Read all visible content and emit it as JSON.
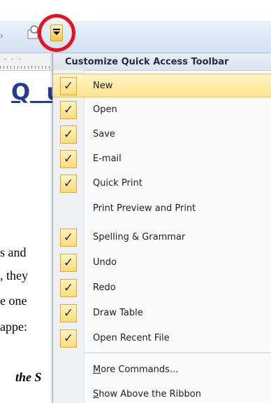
{
  "menu": {
    "title": "Customize Quick Access Toolbar",
    "items": [
      {
        "label": "New",
        "checked": true,
        "active": true
      },
      {
        "label": "Open",
        "checked": true
      },
      {
        "label": "Save",
        "checked": true
      },
      {
        "label": "E-mail",
        "checked": true
      },
      {
        "label": "Quick Print",
        "checked": true
      },
      {
        "label": "Print Preview and Print",
        "checked": false
      },
      {
        "label": "Spelling & Grammar",
        "checked": true
      },
      {
        "label": "Undo",
        "checked": true
      },
      {
        "label": "Redo",
        "checked": true
      },
      {
        "label": "Draw Table",
        "checked": true
      },
      {
        "label": "Open Recent File",
        "checked": true
      }
    ],
    "more_commands_mnemonic": "M",
    "more_commands_rest": "ore Commands...",
    "show_above_mnemonic": "S",
    "show_above_rest": "how Above the Ribbon",
    "check_glyph": "✓"
  },
  "document": {
    "heading": "Q u",
    "lines": [
      "s and",
      ", they",
      "e one",
      "appe:"
    ],
    "italic_line": "the S"
  },
  "colors": {
    "highlight_ring": "#e4141e",
    "heading": "#243c8c",
    "check_fill": "#fddc7a"
  }
}
